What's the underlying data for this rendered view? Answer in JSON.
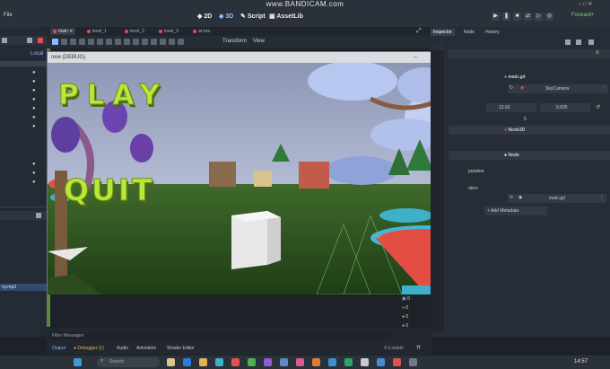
{
  "watermark": "www.BANDICAM.com",
  "topbar": {
    "menu_left": "File",
    "workspaces": [
      "2D",
      "3D",
      "Script",
      "AssetLib"
    ],
    "renderer": "Forward+"
  },
  "scene_tabs": [
    {
      "label": "main",
      "active": true
    },
    {
      "label": "level_1",
      "active": false
    },
    {
      "label": "level_2",
      "active": false
    },
    {
      "label": "level_3",
      "active": false
    },
    {
      "label": "at-rea",
      "active": false
    }
  ],
  "viewport_menu": {
    "transform": "Transform",
    "view": "View"
  },
  "left_dock": {
    "local_label": "Local",
    "file_item": "ny.mp3"
  },
  "game_window": {
    "title": "new (DEBUG)",
    "play_text": "PLAY",
    "quit_text": "QUIT",
    "buttons": [
      "–",
      "□",
      "✕"
    ]
  },
  "inspector": {
    "tabs": [
      {
        "label": "Inspector",
        "active": true
      },
      {
        "label": "Node",
        "active": false
      },
      {
        "label": "History",
        "active": false
      }
    ],
    "resource_title": "main.gd",
    "skycamera_label": "SkyCamera",
    "coord_x": "13.03",
    "coord_y": "9.605",
    "coord_z": "5",
    "section_node3d": "Node3D",
    "section_node": "Node",
    "partial_label_1": "pulation",
    "partial_label_2": "ation",
    "script_value": "main.gd",
    "add_metadata": "Add Metadata"
  },
  "bottom_panel": {
    "filter": "Filter Messages",
    "tabs": [
      "Output",
      "Debugger (1)",
      "Audio",
      "Animation",
      "Shader Editor"
    ],
    "version": "4.3.stable",
    "counts": [
      "0",
      "0",
      "0",
      "0"
    ]
  },
  "taskbar": {
    "search_placeholder": "Search",
    "time": "14:57"
  }
}
